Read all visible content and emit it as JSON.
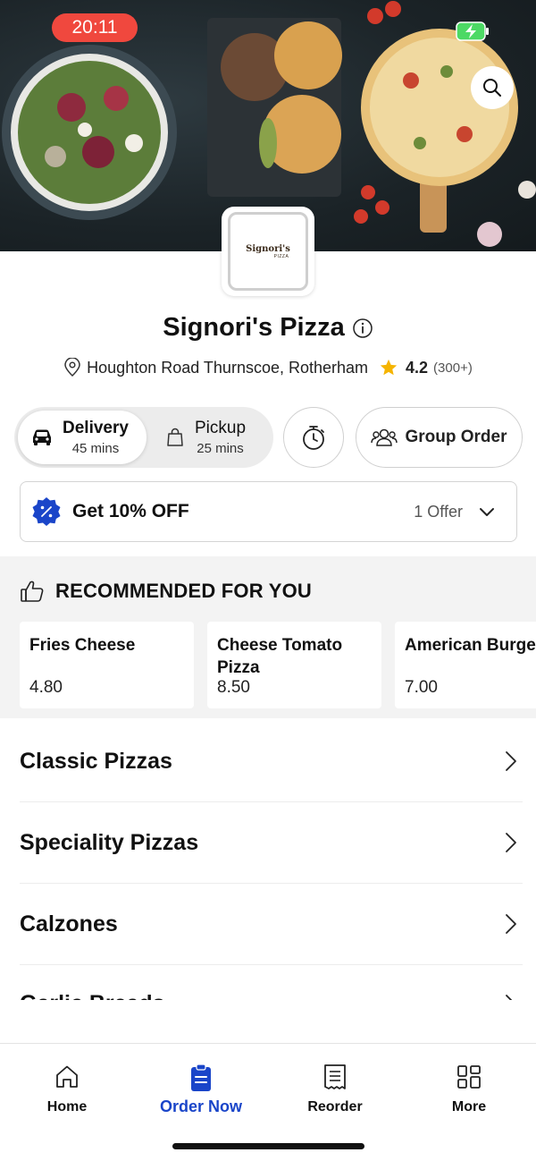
{
  "status_bar": {
    "time": "20:11"
  },
  "restaurant": {
    "logo_text": "Signori's",
    "logo_subtext": "PIZZA",
    "name": "Signori's Pizza",
    "address": "Houghton Road Thurnscoe, Rotherham",
    "rating": "4.2",
    "rating_count": "(300+)"
  },
  "order_mode": {
    "delivery": {
      "label": "Delivery",
      "time": "45 mins"
    },
    "pickup": {
      "label": "Pickup",
      "time": "25 mins"
    },
    "group_order_label": "Group Order"
  },
  "offer": {
    "title": "Get 10% OFF",
    "count": "1 Offer"
  },
  "recommended": {
    "heading": "RECOMMENDED FOR YOU",
    "items": [
      {
        "name": "Fries Cheese",
        "price": "4.80"
      },
      {
        "name": "Cheese Tomato Pizza",
        "price": "8.50"
      },
      {
        "name": "American Burger",
        "price": "7.00"
      }
    ]
  },
  "categories": [
    "Classic Pizzas",
    "Speciality Pizzas",
    "Calzones",
    "Garlic Breads"
  ],
  "tabs": [
    {
      "label": "Home",
      "icon": "home-icon"
    },
    {
      "label": "Order Now",
      "icon": "order-icon"
    },
    {
      "label": "Reorder",
      "icon": "receipt-icon"
    },
    {
      "label": "More",
      "icon": "grid-icon"
    }
  ],
  "colors": {
    "accent": "#1a45c9",
    "time_pill": "#f0483e",
    "star": "#f5b400"
  }
}
